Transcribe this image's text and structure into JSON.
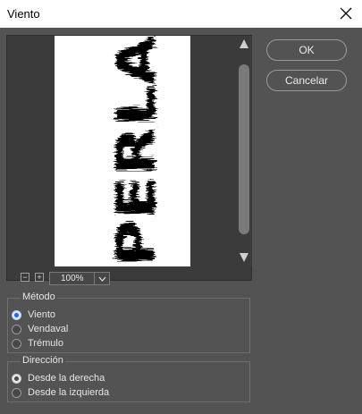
{
  "window": {
    "title": "Viento"
  },
  "preview": {
    "canvas_text": "PERLA",
    "zoom_value": "100%",
    "zoom_out_symbol": "−",
    "zoom_in_symbol": "+"
  },
  "buttons": {
    "ok": "OK",
    "cancel": "Cancelar"
  },
  "metodo": {
    "legend": "Método",
    "options": [
      {
        "label": "Viento",
        "selected": true
      },
      {
        "label": "Vendaval",
        "selected": false
      },
      {
        "label": "Trémulo",
        "selected": false
      }
    ]
  },
  "direccion": {
    "legend": "Dirección",
    "options": [
      {
        "label": "Desde la derecha",
        "selected": true
      },
      {
        "label": "Desde la izquierda",
        "selected": false
      }
    ]
  },
  "icons": [
    "close-icon",
    "scroll-up-icon",
    "scroll-down-icon",
    "zoom-out-icon",
    "zoom-in-icon",
    "chevron-down-icon"
  ]
}
